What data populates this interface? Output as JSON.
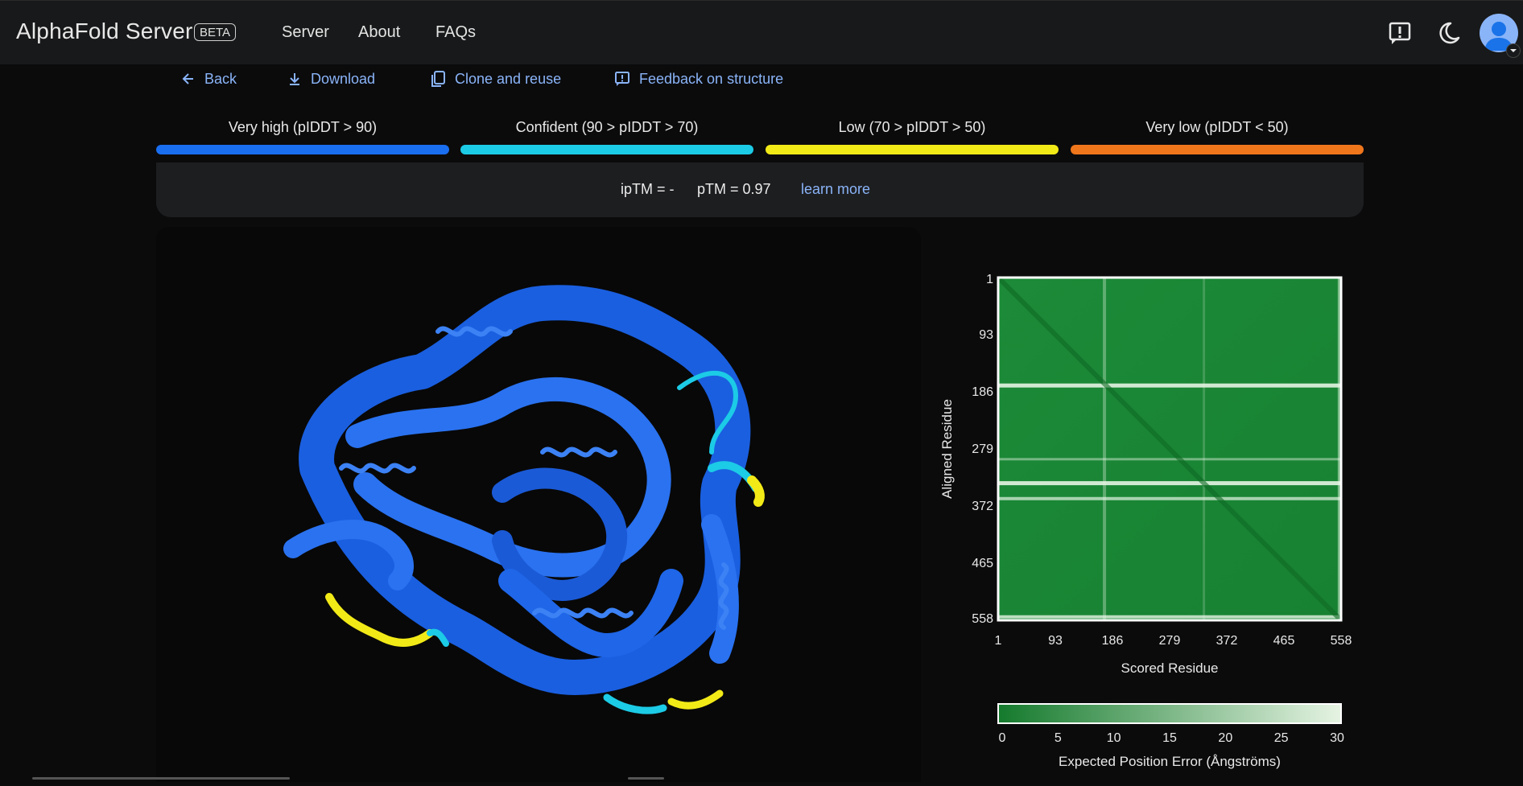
{
  "header": {
    "brand": "AlphaFold Server",
    "badge": "BETA",
    "nav": [
      "Server",
      "About",
      "FAQs"
    ],
    "icons": [
      "feedback-icon",
      "dark-mode-icon",
      "account-avatar"
    ]
  },
  "actions": {
    "back": "Back",
    "download": "Download",
    "clone": "Clone and reuse",
    "feedback": "Feedback on structure"
  },
  "plddt_legend": [
    {
      "label": "Very high (pIDDT > 90)",
      "color": "#1a6ef0"
    },
    {
      "label": "Confident (90 > pIDDT > 70)",
      "color": "#1ccbe6"
    },
    {
      "label": "Low (70 > pIDDT > 50)",
      "color": "#f2ea17"
    },
    {
      "label": "Very low (pIDDT < 50)",
      "color": "#f0761b"
    }
  ],
  "scores": {
    "iptm": "ipTM = -",
    "ptm": "pTM = 0.97",
    "learn_more": "learn more"
  },
  "pae": {
    "y_label": "Aligned Residue",
    "x_label": "Scored Residue",
    "ticks": [
      "1",
      "93",
      "186",
      "279",
      "372",
      "465",
      "558"
    ],
    "colorbar_ticks": [
      "0",
      "5",
      "10",
      "15",
      "20",
      "25",
      "30"
    ],
    "colorbar_label": "Expected Position Error (Ångströms)",
    "colors": {
      "low": "#147a2c",
      "high": "#e6f4e3"
    }
  }
}
